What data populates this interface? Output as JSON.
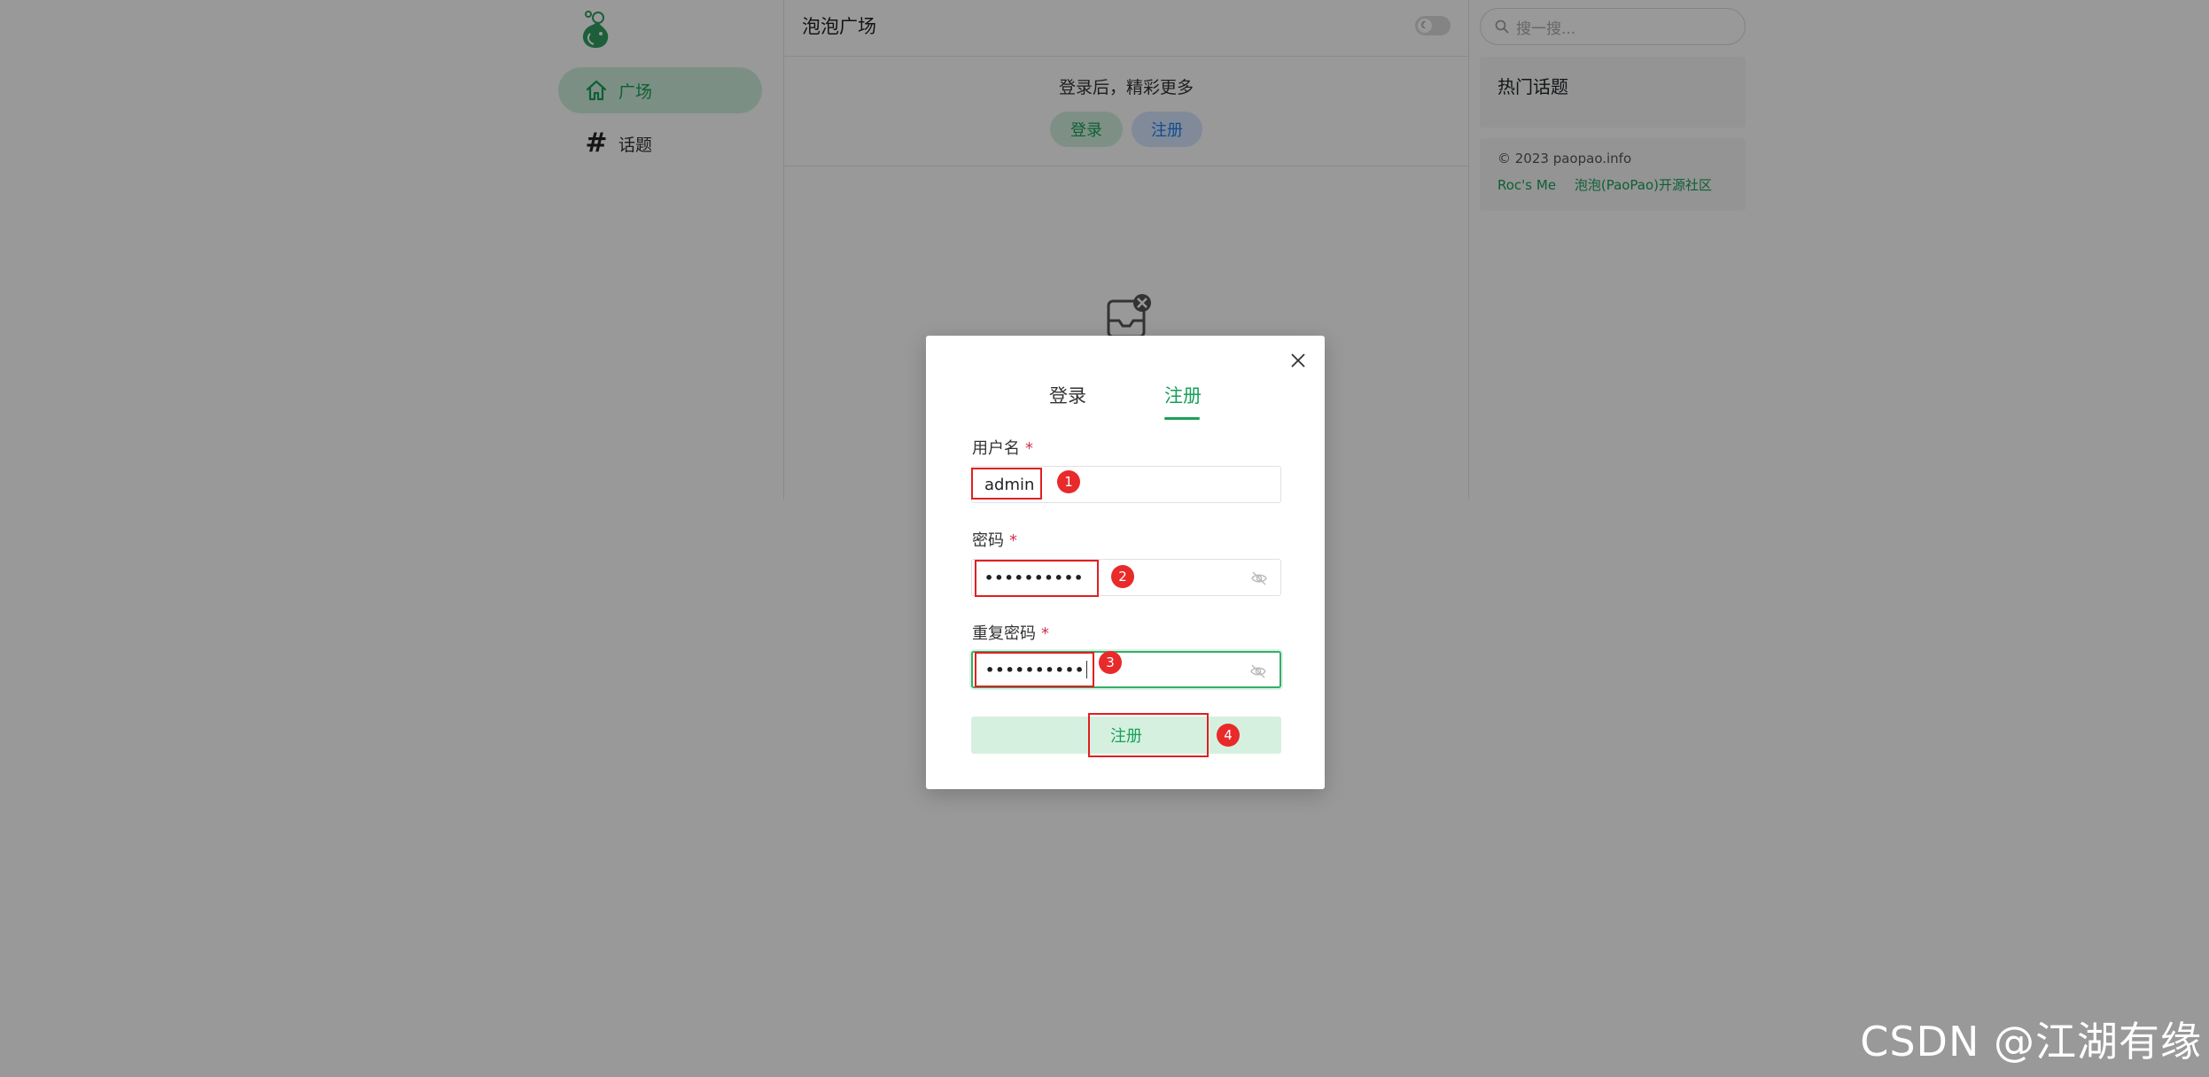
{
  "app": {
    "logo_icon": "paopao-logo-icon",
    "accent_color": "#18a058"
  },
  "sidebar": {
    "items": [
      {
        "label": "广场",
        "icon": "home-icon",
        "active": true
      },
      {
        "label": "话题",
        "icon": "hash-icon",
        "active": false
      }
    ]
  },
  "main": {
    "title": "泡泡广场",
    "login_tip": "登录后，精彩更多",
    "login_button": "登录",
    "register_button": "注册"
  },
  "rightbar": {
    "search_placeholder": "搜一搜...",
    "hot_topics_title": "热门话题",
    "copyright": "© 2023 paopao.info",
    "links": [
      "Roc's Me",
      "泡泡(PaoPao)开源社区"
    ]
  },
  "modal": {
    "tabs": [
      "登录",
      "注册"
    ],
    "active_tab": "注册",
    "username_label": "用户名",
    "username_value": "admin",
    "password_label": "密码",
    "password_value": "••••••••••",
    "repeat_password_label": "重复密码",
    "repeat_password_value": "••••••••••",
    "required_mark": "*",
    "submit_label": "注册"
  },
  "annotations": [
    "1",
    "2",
    "3",
    "4"
  ],
  "watermark": "CSDN @江湖有缘"
}
